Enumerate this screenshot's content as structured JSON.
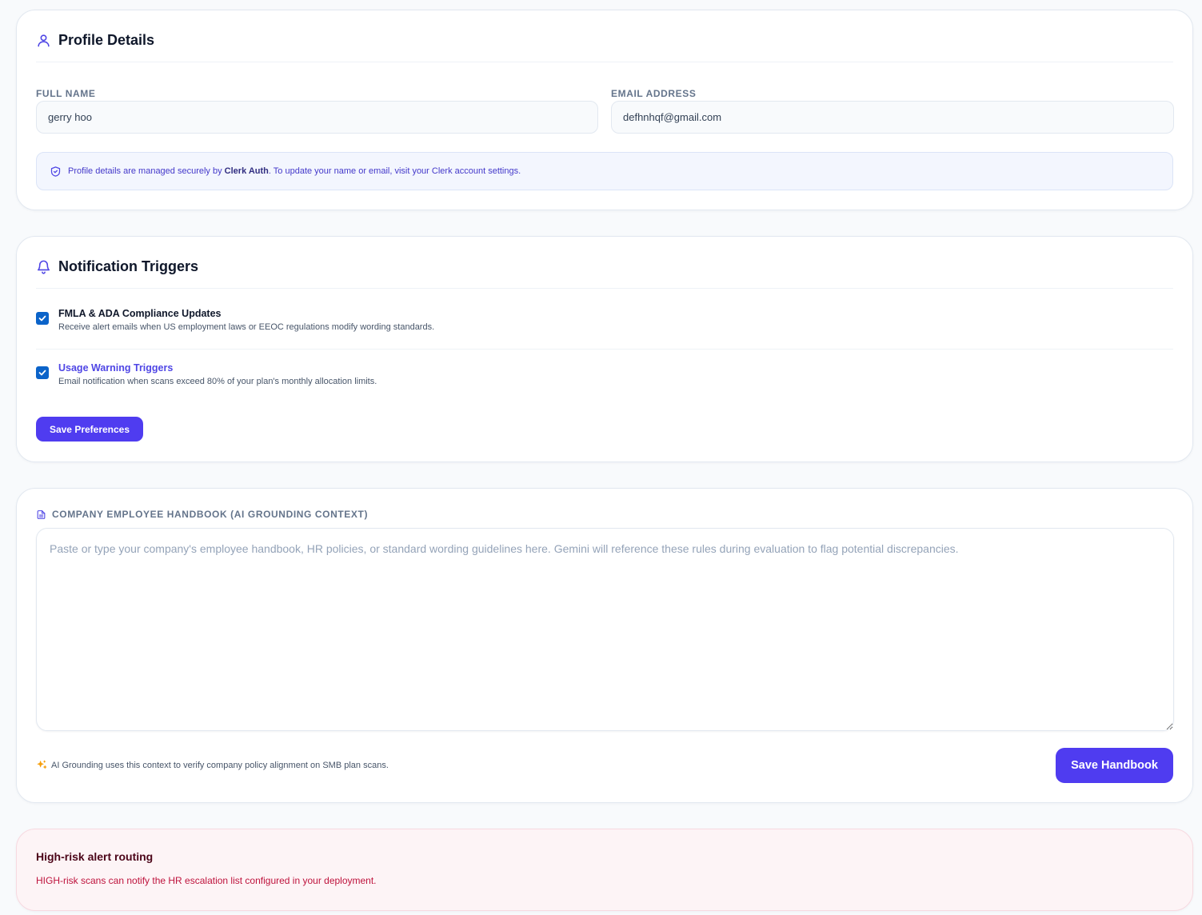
{
  "profile": {
    "title": "Profile Details",
    "full_name_label": "FULL NAME",
    "full_name_value": "gerry hoo",
    "email_label": "EMAIL ADDRESS",
    "email_value": "defhnhqf@gmail.com",
    "info_prefix": "Profile details are managed securely by ",
    "info_brand": "Clerk Auth",
    "info_suffix": ". To update your name or email, visit your Clerk account settings."
  },
  "notifications": {
    "title": "Notification Triggers",
    "triggers": [
      {
        "title": "FMLA & ADA Compliance Updates",
        "description": "Receive alert emails when US employment laws or EEOC regulations modify wording standards.",
        "checked": true
      },
      {
        "title": "Usage Warning Triggers",
        "description": "Email notification when scans exceed 80% of your plan's monthly allocation limits.",
        "checked": true
      }
    ],
    "save_label": "Save Preferences"
  },
  "handbook": {
    "label": "COMPANY EMPLOYEE HANDBOOK (AI GROUNDING CONTEXT)",
    "placeholder": "Paste or type your company's employee handbook, HR policies, or standard wording guidelines here. Gemini will reference these rules during evaluation to flag potential discrepancies.",
    "note": "AI Grounding uses this context to verify company policy alignment on SMB plan scans.",
    "save_label": "Save Handbook"
  },
  "alert": {
    "title": "High-risk alert routing",
    "description": "HIGH-risk scans can notify the HR escalation list configured in your deployment."
  },
  "colors": {
    "accent": "#4f3cf0",
    "checkbox": "#0b63c9",
    "alert_bg": "#fdf4f6",
    "alert_text": "#be123c"
  },
  "icons": {
    "profile": "user-icon",
    "info": "shield-check-icon",
    "notifications": "bell-icon",
    "handbook": "document-icon",
    "note": "sparkles-icon"
  }
}
